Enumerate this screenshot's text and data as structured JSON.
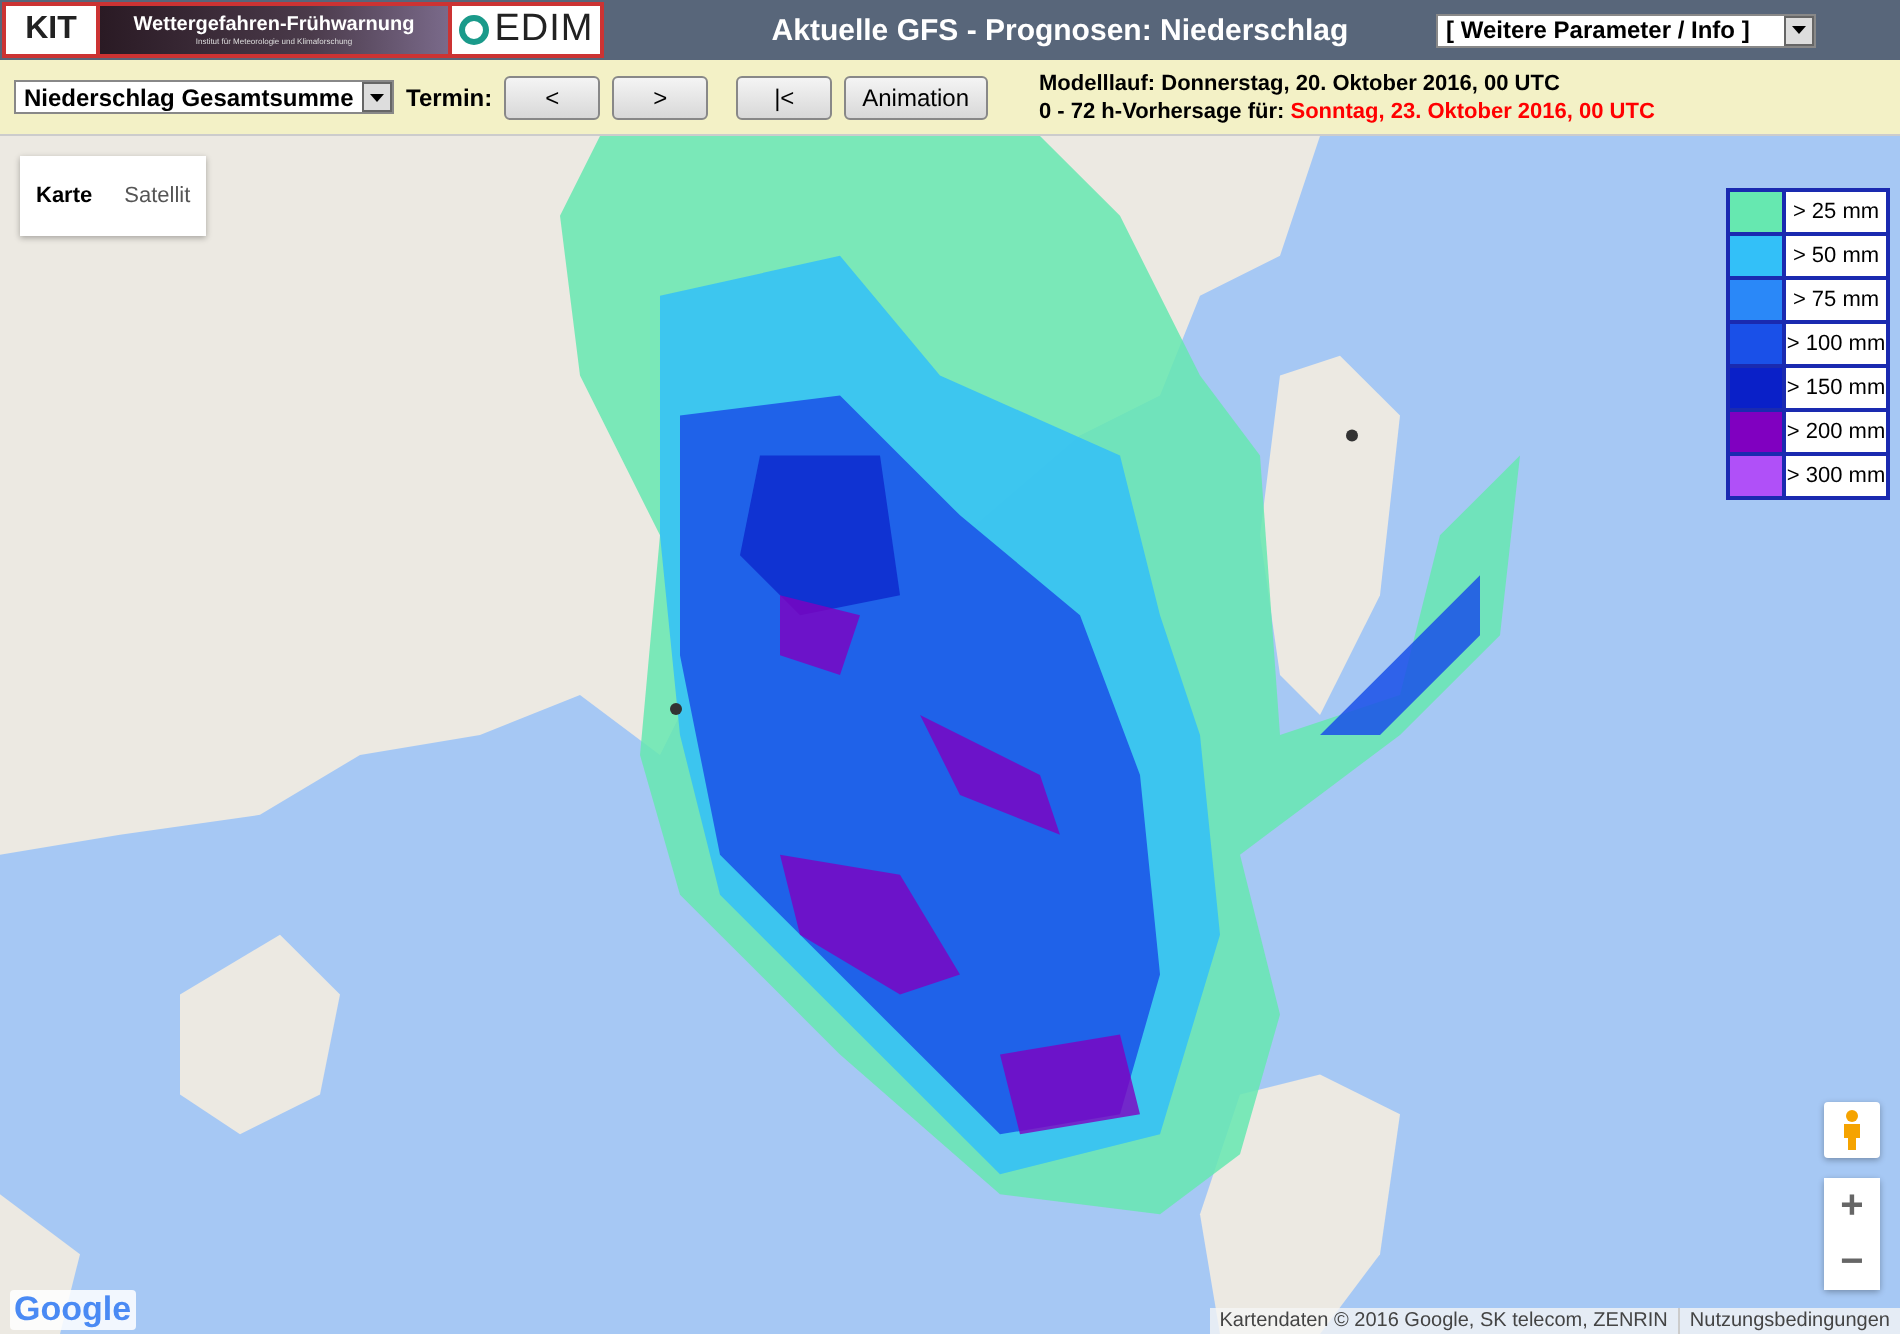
{
  "header": {
    "kit_logo": "KIT",
    "banner_title": "Wettergefahren-Frühwarnung",
    "banner_subtitle": "Institut für Meteorologie und Klimaforschung",
    "cedim_logo": "EDIM",
    "title": "Aktuelle GFS - Prognosen: Niederschlag",
    "info_select": {
      "value": "[ Weitere Parameter / Info ]"
    }
  },
  "toolbar": {
    "parameter_select": {
      "value": "Niederschlag Gesamtsumme"
    },
    "termin_label": "Termin:",
    "buttons": [
      {
        "label": "<"
      },
      {
        "label": ">"
      },
      {
        "label": "|<"
      },
      {
        "label": "Animation"
      }
    ],
    "model_run": {
      "label": "Modelllauf:",
      "value": "Donnerstag, 20. Oktober 2016, 00 UTC",
      "color": "#000000"
    },
    "forecast": {
      "label": "0 - 72 h-Vorhersage für:",
      "value": "Sonntag, 23. Oktober 2016, 00 UTC",
      "color": "#ff0000"
    }
  },
  "map": {
    "type_buttons": [
      {
        "label": "Karte",
        "selected": true
      },
      {
        "label": "Satellit",
        "selected": false
      }
    ],
    "legend": [
      {
        "label": "> 25 mm",
        "color": "#66e8b0"
      },
      {
        "label": "> 50 mm",
        "color": "#33c0f8"
      },
      {
        "label": "> 75 mm",
        "color": "#2a88f8"
      },
      {
        "label": "> 100 mm",
        "color": "#1a50e8"
      },
      {
        "label": "> 150 mm",
        "color": "#0a20c8"
      },
      {
        "label": "> 200 mm",
        "color": "#8000c0"
      },
      {
        "label": "> 300 mm",
        "color": "#b050f8"
      }
    ],
    "zoom_in": "+",
    "zoom_out": "−",
    "google_logo": "Google",
    "attribution": "Kartendaten © 2016 Google, SK telecom, ZENRIN",
    "terms": "Nutzungsbedingungen"
  }
}
